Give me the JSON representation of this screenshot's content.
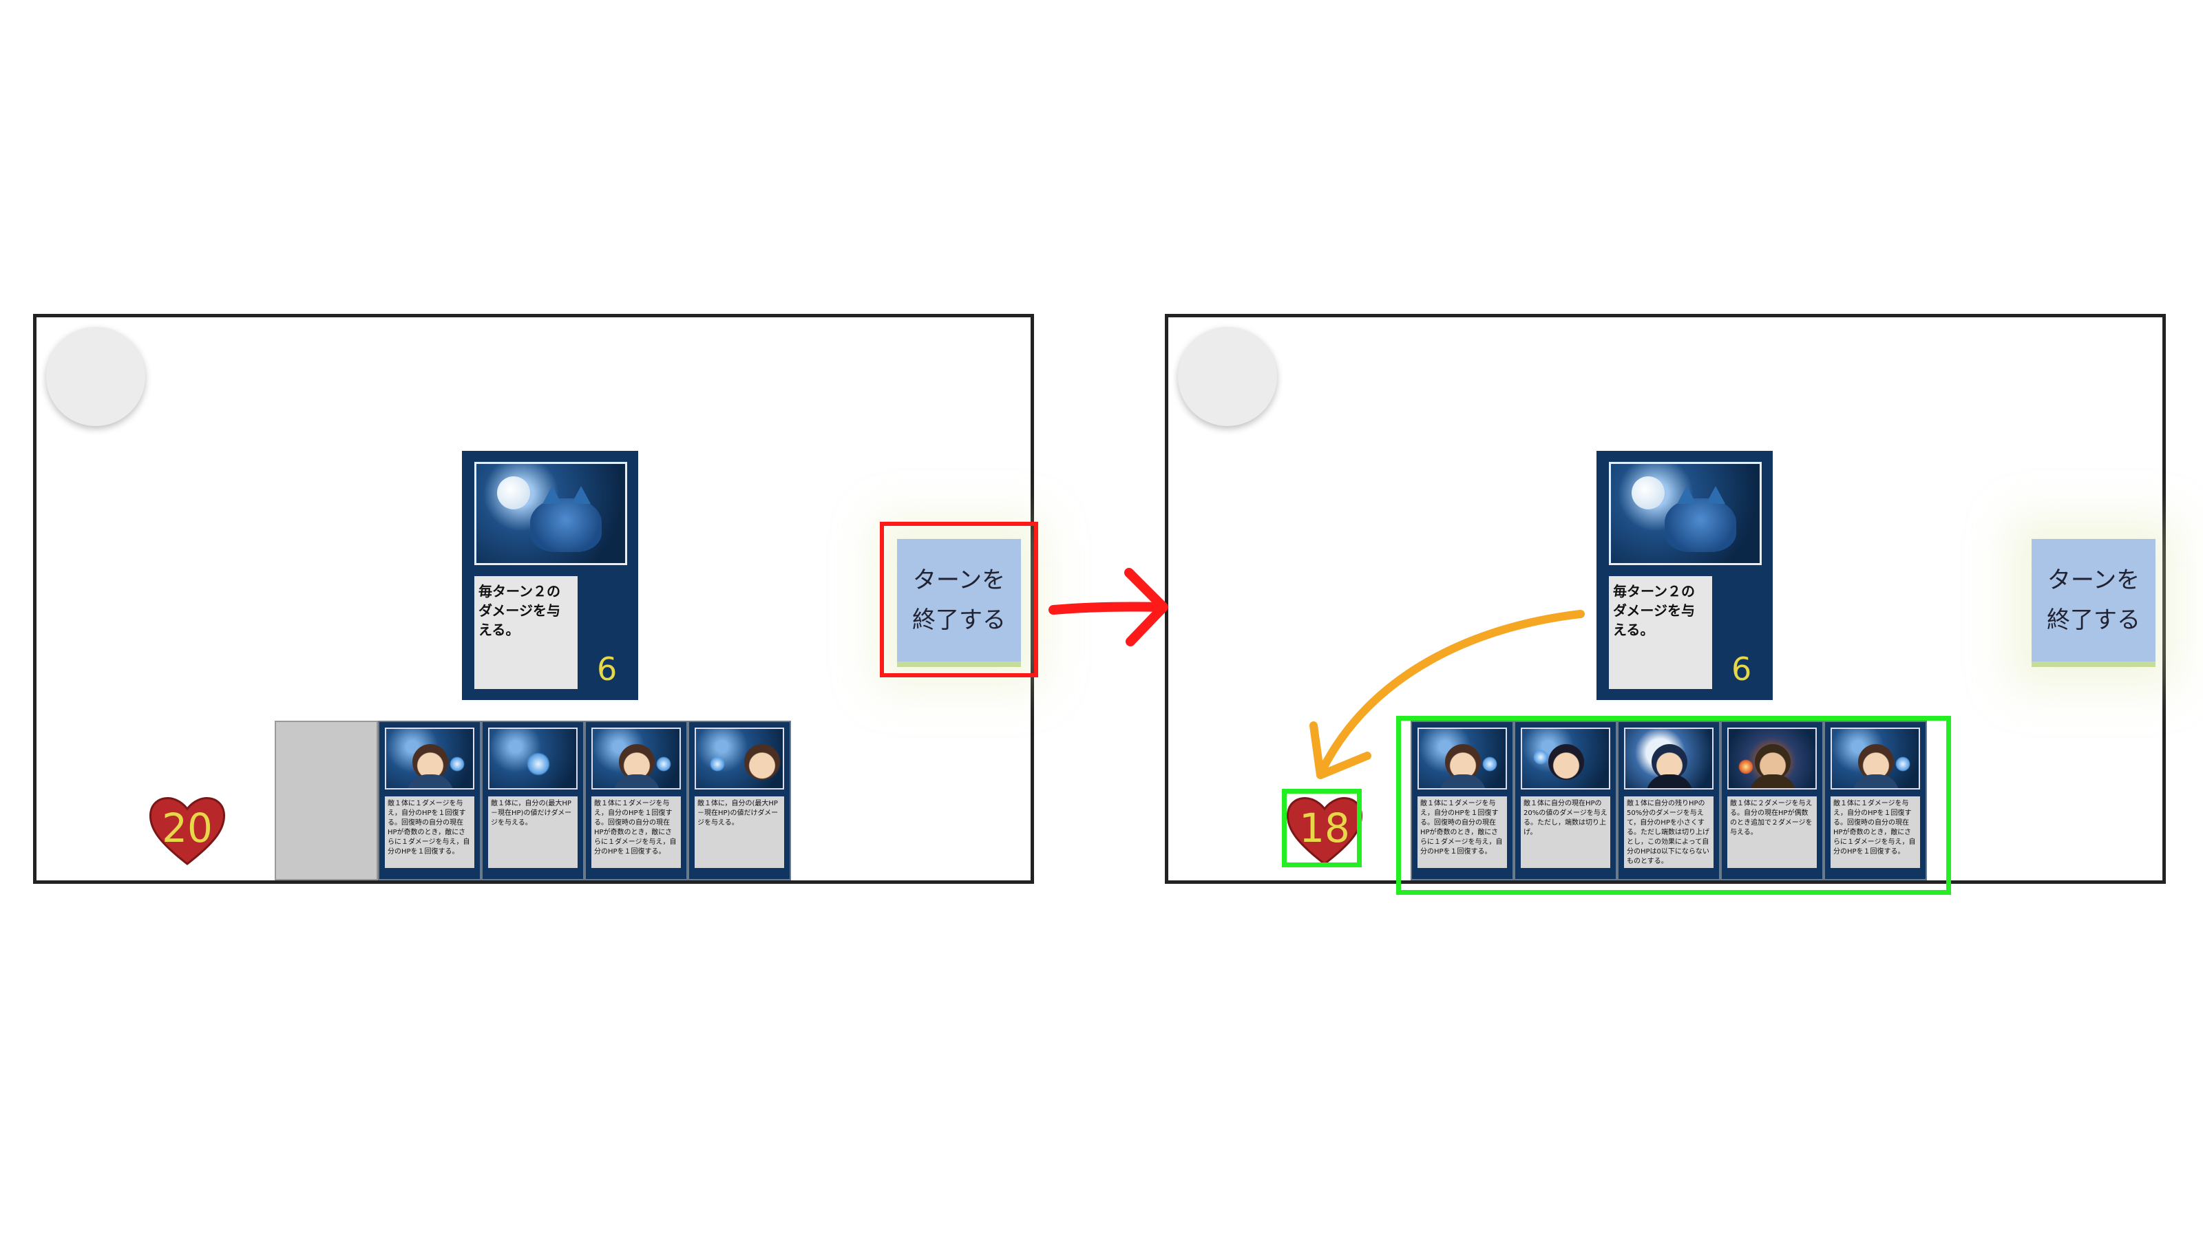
{
  "left_panel": {
    "enemy_card": {
      "description": "毎ターン２のダメージを与える。",
      "cost": "6"
    },
    "end_turn_label": "ターンを\n終了する",
    "player_hp": "20",
    "hand": [
      {
        "text": "敵１体に１ダメージを与え，自分のHPを１回復する。回復時の自分の現在HPが奇数のとき，敵にさらに１ダメージを与え，自分のHPを１回復する。"
      },
      {
        "text": "敵１体に，自分の(最大HP－現在HP)の値だけダメージを与える。"
      },
      {
        "text": "敵１体に１ダメージを与え，自分のHPを１回復する。回復時の自分の現在HPが奇数のとき，敵にさらに１ダメージを与え，自分のHPを１回復する。"
      },
      {
        "text": "敵１体に，自分の(最大HP－現在HP)の値だけダメージを与える。"
      }
    ]
  },
  "right_panel": {
    "enemy_card": {
      "description": "毎ターン２のダメージを与える。",
      "cost": "6"
    },
    "end_turn_label": "ターンを\n終了する",
    "player_hp": "18",
    "hand": [
      {
        "text": "敵１体に１ダメージを与え，自分のHPを１回復する。回復時の自分の現在HPが奇数のとき，敵にさらに１ダメージを与え，自分のHPを１回復する。"
      },
      {
        "text": "敵１体に自分の現在HPの20%の値のダメージを与える。ただし，端数は切り上げ。"
      },
      {
        "text": "敵１体に自分の残りHPの50%分のダメージを与えて，自分のHPを小さくする。ただし端数は切り上げとし，この効果によって自分のHPは0以下にならないものとする。"
      },
      {
        "text": "敵１体に２ダメージを与える。自分の現在HPが偶数のとき追加で２ダメージを与える。"
      },
      {
        "text": "敵１体に１ダメージを与え，自分のHPを１回復する。回復時の自分の現在HPが奇数のとき，敵にさらに１ダメージを与え，自分のHPを１回復する。"
      }
    ]
  },
  "colors": {
    "highlight_red": "#ff1a1a",
    "highlight_green": "#22ee22",
    "arrow_orange": "#f5a623",
    "card_navy": "#0f3560"
  }
}
